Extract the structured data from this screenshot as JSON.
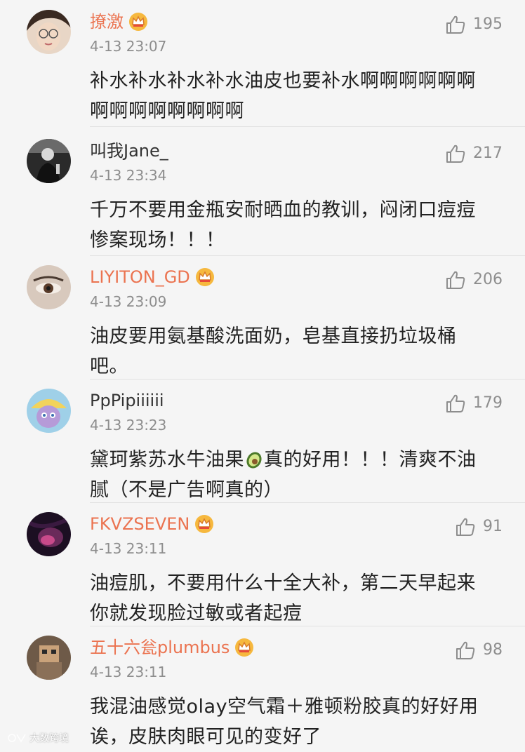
{
  "colors": {
    "vip_name": "#eb7350",
    "plain_name": "#333333",
    "meta": "#8d8d8d",
    "body_text": "#222222",
    "background": "#f5f5f5"
  },
  "comments": [
    {
      "username": "撩激",
      "vip": true,
      "time": "4-13 23:07",
      "likes": "195",
      "lines": [
        "补水补水补水补水油皮也要补水啊啊啊啊啊啊",
        "啊啊啊啊啊啊啊啊"
      ]
    },
    {
      "username": "叫我Jane_",
      "vip": false,
      "time": "4-13 23:34",
      "likes": "217",
      "lines": [
        "千万不要用金瓶安耐晒血的教训，闷闭口痘痘",
        "惨案现场！！！"
      ]
    },
    {
      "username": "LIYITON_GD",
      "vip": true,
      "time": "4-13 23:09",
      "likes": "206",
      "lines": [
        "油皮要用氨基酸洗面奶，皂基直接扔垃圾桶",
        "吧。"
      ]
    },
    {
      "username": "PpPipiiiiii",
      "vip": false,
      "time": "4-13 23:23",
      "likes": "179",
      "lines": [
        "黛珂紫苏水牛油果",
        "真的好用！！！清爽不油",
        "腻（不是广告啊真的）"
      ]
    },
    {
      "username": "FKVZSEVEN",
      "vip": true,
      "time": "4-13 23:11",
      "likes": "91",
      "lines": [
        "油痘肌，不要用什么十全大补，第二天早起来",
        "你就发现脸过敏或者起痘"
      ]
    },
    {
      "username": "五十六瓮plumbus",
      "vip": true,
      "time": "4-13 23:11",
      "likes": "98",
      "lines": [
        "我混油感觉olay空气霜＋雅顿粉胶真的好好用",
        "诶，皮肤肉眼可见的变好了"
      ]
    }
  ],
  "icons": {
    "like": "thumbs-up-icon",
    "vip": "crown-icon",
    "emoji": "avocado-icon"
  },
  "watermark": {
    "text": "大数跨境"
  }
}
